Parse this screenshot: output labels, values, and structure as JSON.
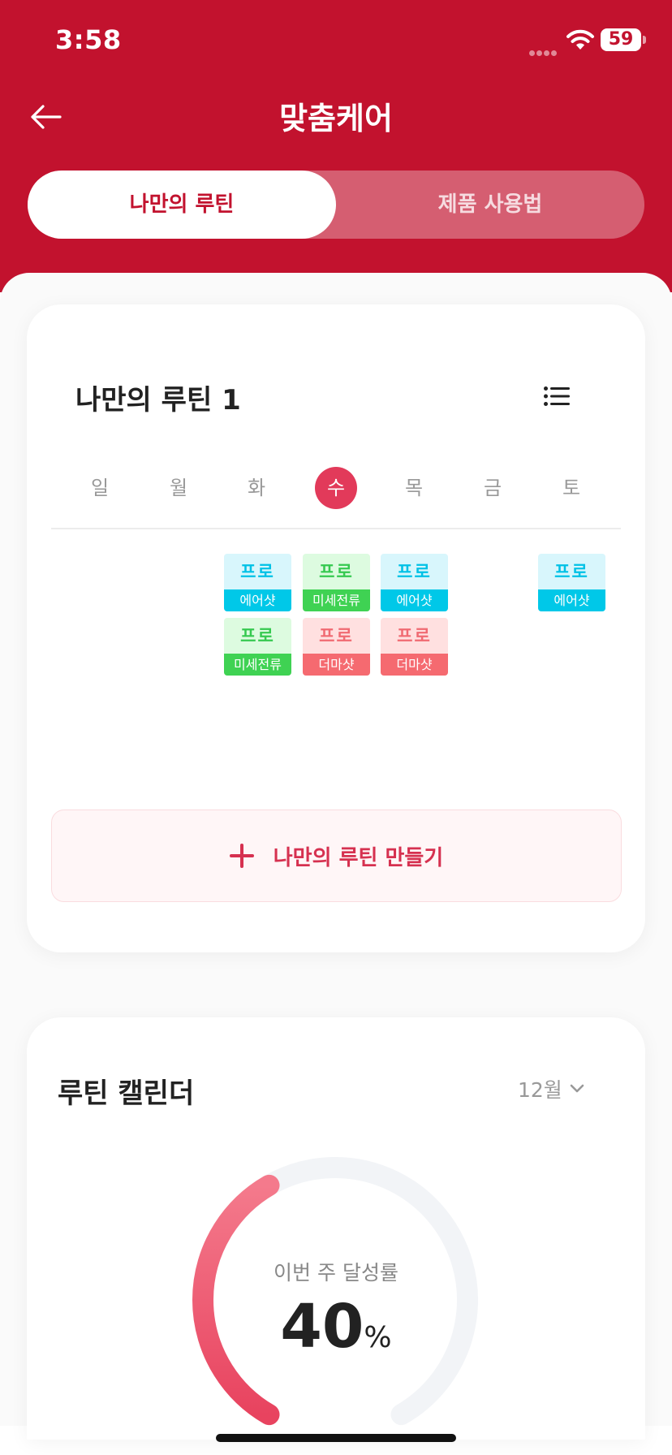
{
  "status_bar": {
    "time": "3:58",
    "battery": "59"
  },
  "header": {
    "title": "맞춤케어",
    "back_icon": "arrow-left-icon"
  },
  "tabs": [
    {
      "label": "나만의 루틴",
      "active": true
    },
    {
      "label": "제품 사용법",
      "active": false
    }
  ],
  "routine_card": {
    "title": "나만의 루틴 1",
    "menu_icon": "list-icon",
    "days": [
      "일",
      "월",
      "화",
      "수",
      "목",
      "금",
      "토"
    ],
    "selected_day": "수",
    "chips": {
      "tue_1": {
        "top": "프로",
        "bottom": "에어샷"
      },
      "tue_2": {
        "top": "프로",
        "bottom": "미세전류"
      },
      "wed_1": {
        "top": "프로",
        "bottom": "미세전류"
      },
      "wed_2": {
        "top": "프로",
        "bottom": "더마샷"
      },
      "thu_1": {
        "top": "프로",
        "bottom": "에어샷"
      },
      "thu_2": {
        "top": "프로",
        "bottom": "더마샷"
      },
      "sat_1": {
        "top": "프로",
        "bottom": "에어샷"
      }
    },
    "create_label": "나만의 루틴 만들기"
  },
  "calendar_card": {
    "title": "루틴 캘린더",
    "month": "12월",
    "gauge_label": "이번 주 달성률",
    "gauge_value": "40",
    "gauge_unit": "%",
    "gauge_fraction": 0.4
  },
  "colors": {
    "brand_red": "#C2122E",
    "accent_pink": "#E23A5A",
    "air_shot": "#00C8E8",
    "micro_current": "#3FD253",
    "derma_shot": "#F56A70"
  }
}
